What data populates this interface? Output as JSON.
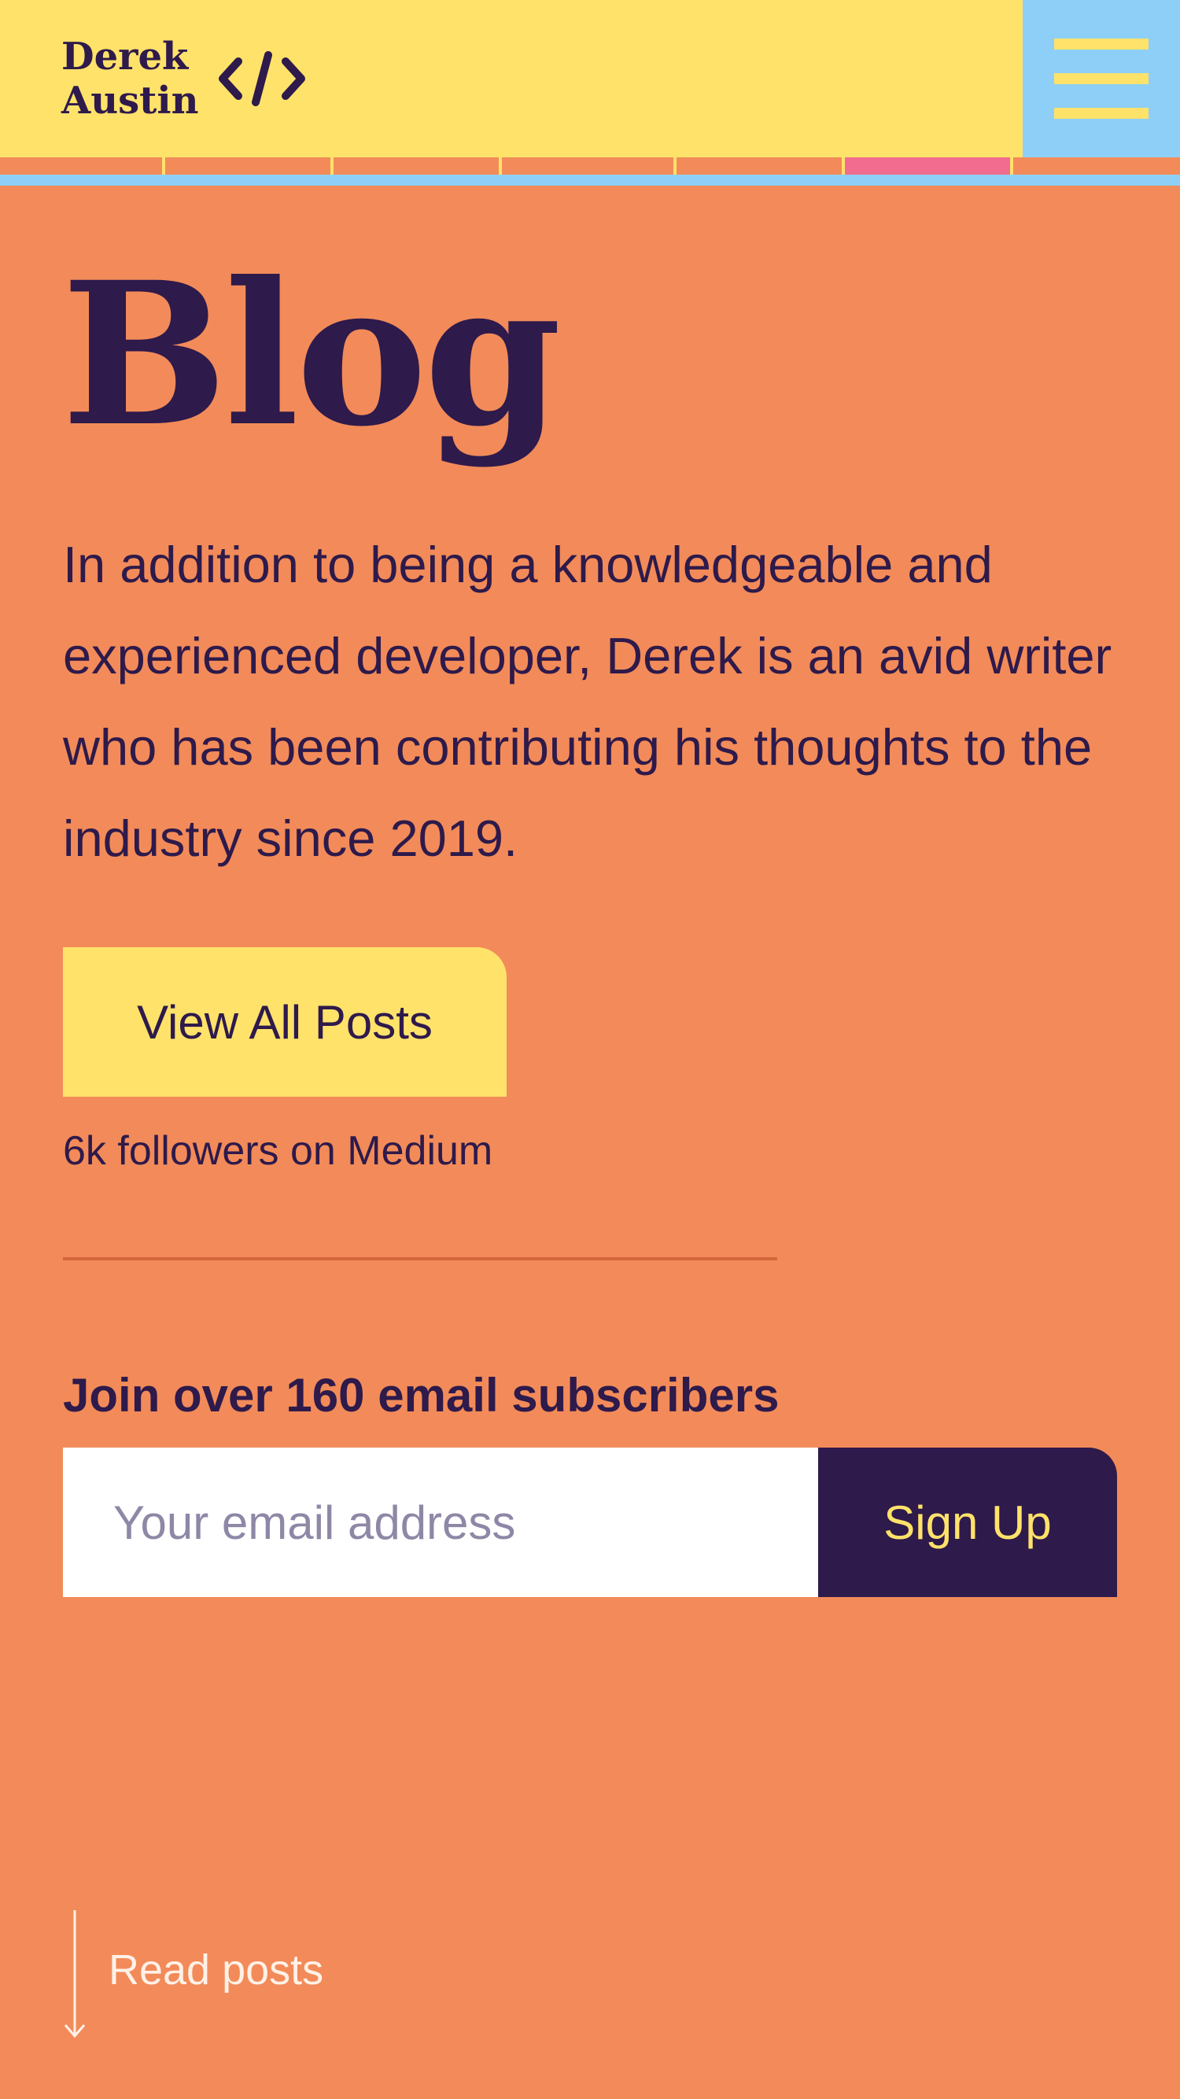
{
  "header": {
    "logo_line1": "Derek",
    "logo_line2": "Austin",
    "logo_icon": "code-brackets-icon",
    "menu_icon": "hamburger-menu-icon"
  },
  "nav_strip": {
    "segments": 7,
    "active_index": 5
  },
  "main": {
    "title": "Blog",
    "intro": "In addition to being a knowledgeable and experienced developer, Derek is an avid writer who has been contributing his thoughts to the industry since 2019.",
    "cta_label": "View All Posts",
    "followers": "6k followers on Medium"
  },
  "newsletter": {
    "heading": "Join over 160 email subscribers",
    "email_placeholder": "Your email address",
    "email_value": "",
    "submit_label": "Sign Up"
  },
  "footer": {
    "read_posts_label": "Read posts",
    "arrow_icon": "arrow-down-icon"
  },
  "colors": {
    "background": "#F28B59",
    "header": "#FFE26A",
    "menu": "#8ECFF8",
    "text": "#2E1A4B",
    "active_segment": "#F26C8F",
    "button_yellow": "#FFE26A",
    "button_dark": "#2E1A4B"
  }
}
